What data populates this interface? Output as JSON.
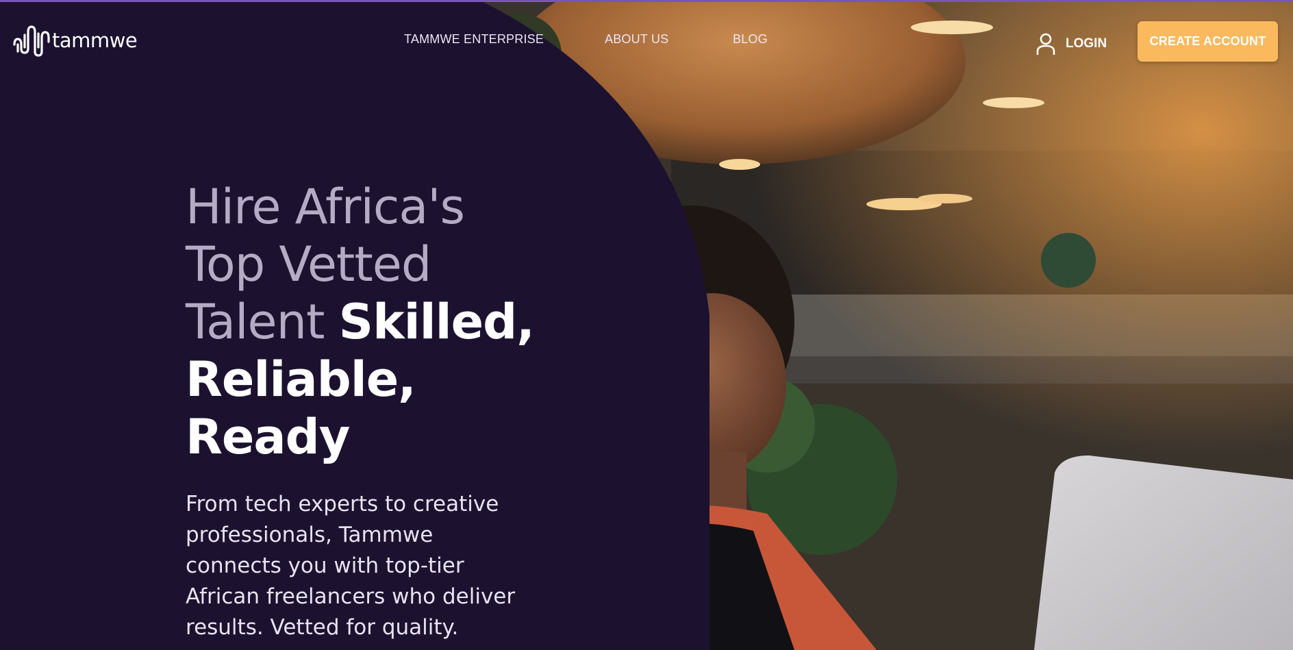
{
  "brand": {
    "name": "tammwe",
    "accent_color": "#fbb95e",
    "background_color": "#1c1230",
    "strip_color": "#7a55b8"
  },
  "nav": {
    "items": [
      {
        "label": "TAMMWE ENTERPRISE"
      },
      {
        "label": "ABOUT US"
      },
      {
        "label": "BLOG"
      }
    ],
    "login_label": "LOGIN",
    "login_icon": "user-icon",
    "cta_label": "CREATE ACCOUNT"
  },
  "hero": {
    "headline_light": "Hire Africa's Top Vetted Talent ",
    "headline_bold": "Skilled, Reliable, Ready",
    "subtitle": "From tech experts to creative professionals, Tammwe connects you with top-tier African freelancers who deliver results. Vetted for quality.",
    "image": "woman-with-laptop-photo"
  }
}
